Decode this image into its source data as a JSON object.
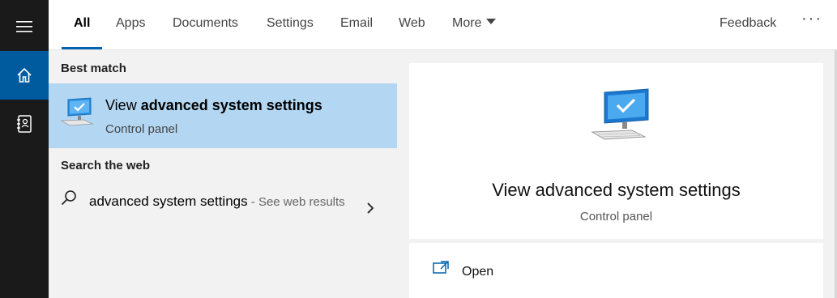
{
  "tabs": [
    {
      "label": "All"
    },
    {
      "label": "Apps"
    },
    {
      "label": "Documents"
    },
    {
      "label": "Settings"
    },
    {
      "label": "Email"
    },
    {
      "label": "Web"
    },
    {
      "label": "More"
    }
  ],
  "header": {
    "feedback_label": "Feedback",
    "more_options": "···"
  },
  "results": {
    "best_match_heading": "Best match",
    "best_match": {
      "title_plain": "View ",
      "title_bold": "advanced system settings",
      "subtitle": "Control panel",
      "icon": "monitor-check-icon"
    },
    "web_heading": "Search the web",
    "web_item": {
      "query": "advanced system settings",
      "hint": " - See web results",
      "icon": "search-icon"
    }
  },
  "preview": {
    "title": "View advanced system settings",
    "subtitle": "Control panel",
    "icon": "monitor-check-icon",
    "actions": [
      {
        "label": "Open",
        "icon": "open-external-icon"
      }
    ]
  },
  "colors": {
    "accent": "#0063b1",
    "rail": "#1a1a1a",
    "rail_active": "#005a9e",
    "selection": "#b3d7f3"
  }
}
